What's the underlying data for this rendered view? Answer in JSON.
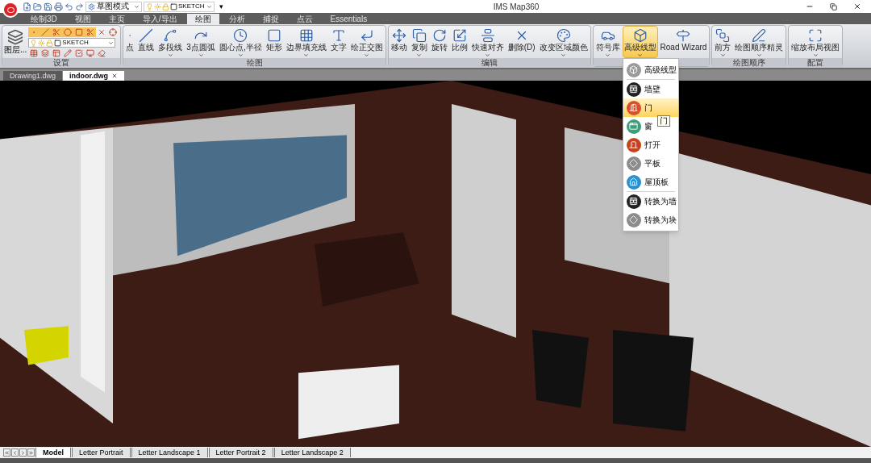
{
  "title_bar": {
    "mode_dropdown": "草图模式",
    "layer_combo": "SKETCH",
    "customize": "▾",
    "title": "IMS Map360"
  },
  "ribbon_tabs": [
    {
      "label": "绘制3D",
      "selected": false
    },
    {
      "label": "视图",
      "selected": false
    },
    {
      "label": "主页",
      "selected": false
    },
    {
      "label": "导入/导出",
      "selected": false
    },
    {
      "label": "绘图",
      "selected": true
    },
    {
      "label": "分析",
      "selected": false
    },
    {
      "label": "捕捉",
      "selected": false
    },
    {
      "label": "点云",
      "selected": false
    },
    {
      "label": "Essentials",
      "selected": false
    }
  ],
  "ribbon_groups": [
    {
      "kind": "layers",
      "title": "设置",
      "layers_button": "图层...",
      "layer_combo": "SKETCH"
    },
    {
      "kind": "tools",
      "title": "绘图",
      "buttons": [
        {
          "label": "点",
          "has_menu": false
        },
        {
          "label": "直线",
          "has_menu": false
        },
        {
          "label": "多段线",
          "has_menu": true
        },
        {
          "label": "3点圆弧",
          "has_menu": true
        },
        {
          "label": "圆心点,半径",
          "has_menu": true
        },
        {
          "label": "矩形",
          "has_menu": false
        },
        {
          "label": "边界填充线",
          "has_menu": true
        },
        {
          "label": "文字",
          "has_menu": false
        },
        {
          "label": "绘正交图",
          "has_menu": true
        }
      ]
    },
    {
      "kind": "tools",
      "title": "编辑",
      "buttons": [
        {
          "label": "移动",
          "has_menu": false
        },
        {
          "label": "复制",
          "has_menu": true
        },
        {
          "label": "旋转",
          "has_menu": false
        },
        {
          "label": "比例",
          "has_menu": false
        },
        {
          "label": "快速对齐",
          "has_menu": true
        },
        {
          "label": "删除(D)",
          "has_menu": false
        },
        {
          "label": "改变区域颜色",
          "has_menu": true
        }
      ]
    },
    {
      "kind": "tools",
      "buttons": [
        {
          "label": "符号库",
          "has_menu": true,
          "open": false
        },
        {
          "label": "高级线型",
          "has_menu": true,
          "open": true
        },
        {
          "label": "Road Wizard",
          "has_menu": false,
          "open": false
        }
      ]
    },
    {
      "kind": "tools",
      "title": "绘图顺序",
      "buttons": [
        {
          "label": "前方",
          "has_menu": true
        },
        {
          "label": "绘图顺序精灵",
          "has_menu": true
        }
      ]
    },
    {
      "kind": "tools",
      "title": "配置",
      "buttons": [
        {
          "label": "缩放布局视图",
          "has_menu": true
        }
      ]
    }
  ],
  "dropdown_menu": {
    "tooltip": "门",
    "items": [
      {
        "label": "高级线型",
        "selected": false,
        "separator_after": true
      },
      {
        "label": "墙壁",
        "selected": false,
        "separator_after": false
      },
      {
        "label": "门",
        "selected": true,
        "separator_after": false
      },
      {
        "label": "窗",
        "selected": false,
        "separator_after": false
      },
      {
        "label": "打开",
        "selected": false,
        "separator_after": false
      },
      {
        "label": "平板",
        "selected": false,
        "separator_after": false
      },
      {
        "label": "屋顶板",
        "selected": false,
        "separator_after": true
      },
      {
        "label": "转换为墙",
        "selected": false,
        "separator_after": false
      },
      {
        "label": "转换为块",
        "selected": false,
        "separator_after": false
      }
    ]
  },
  "document_tabs": [
    {
      "label": "Drawing1.dwg",
      "selected": false
    },
    {
      "label": "indoor.dwg",
      "selected": true
    }
  ],
  "layout_tabs": [
    {
      "label": "Model",
      "selected": true
    },
    {
      "label": "Letter Portrait",
      "selected": false
    },
    {
      "label": "Letter Landscape 1",
      "selected": false
    },
    {
      "label": "Letter Portrait 2",
      "selected": false
    },
    {
      "label": "Letter Landscape 2",
      "selected": false
    }
  ]
}
